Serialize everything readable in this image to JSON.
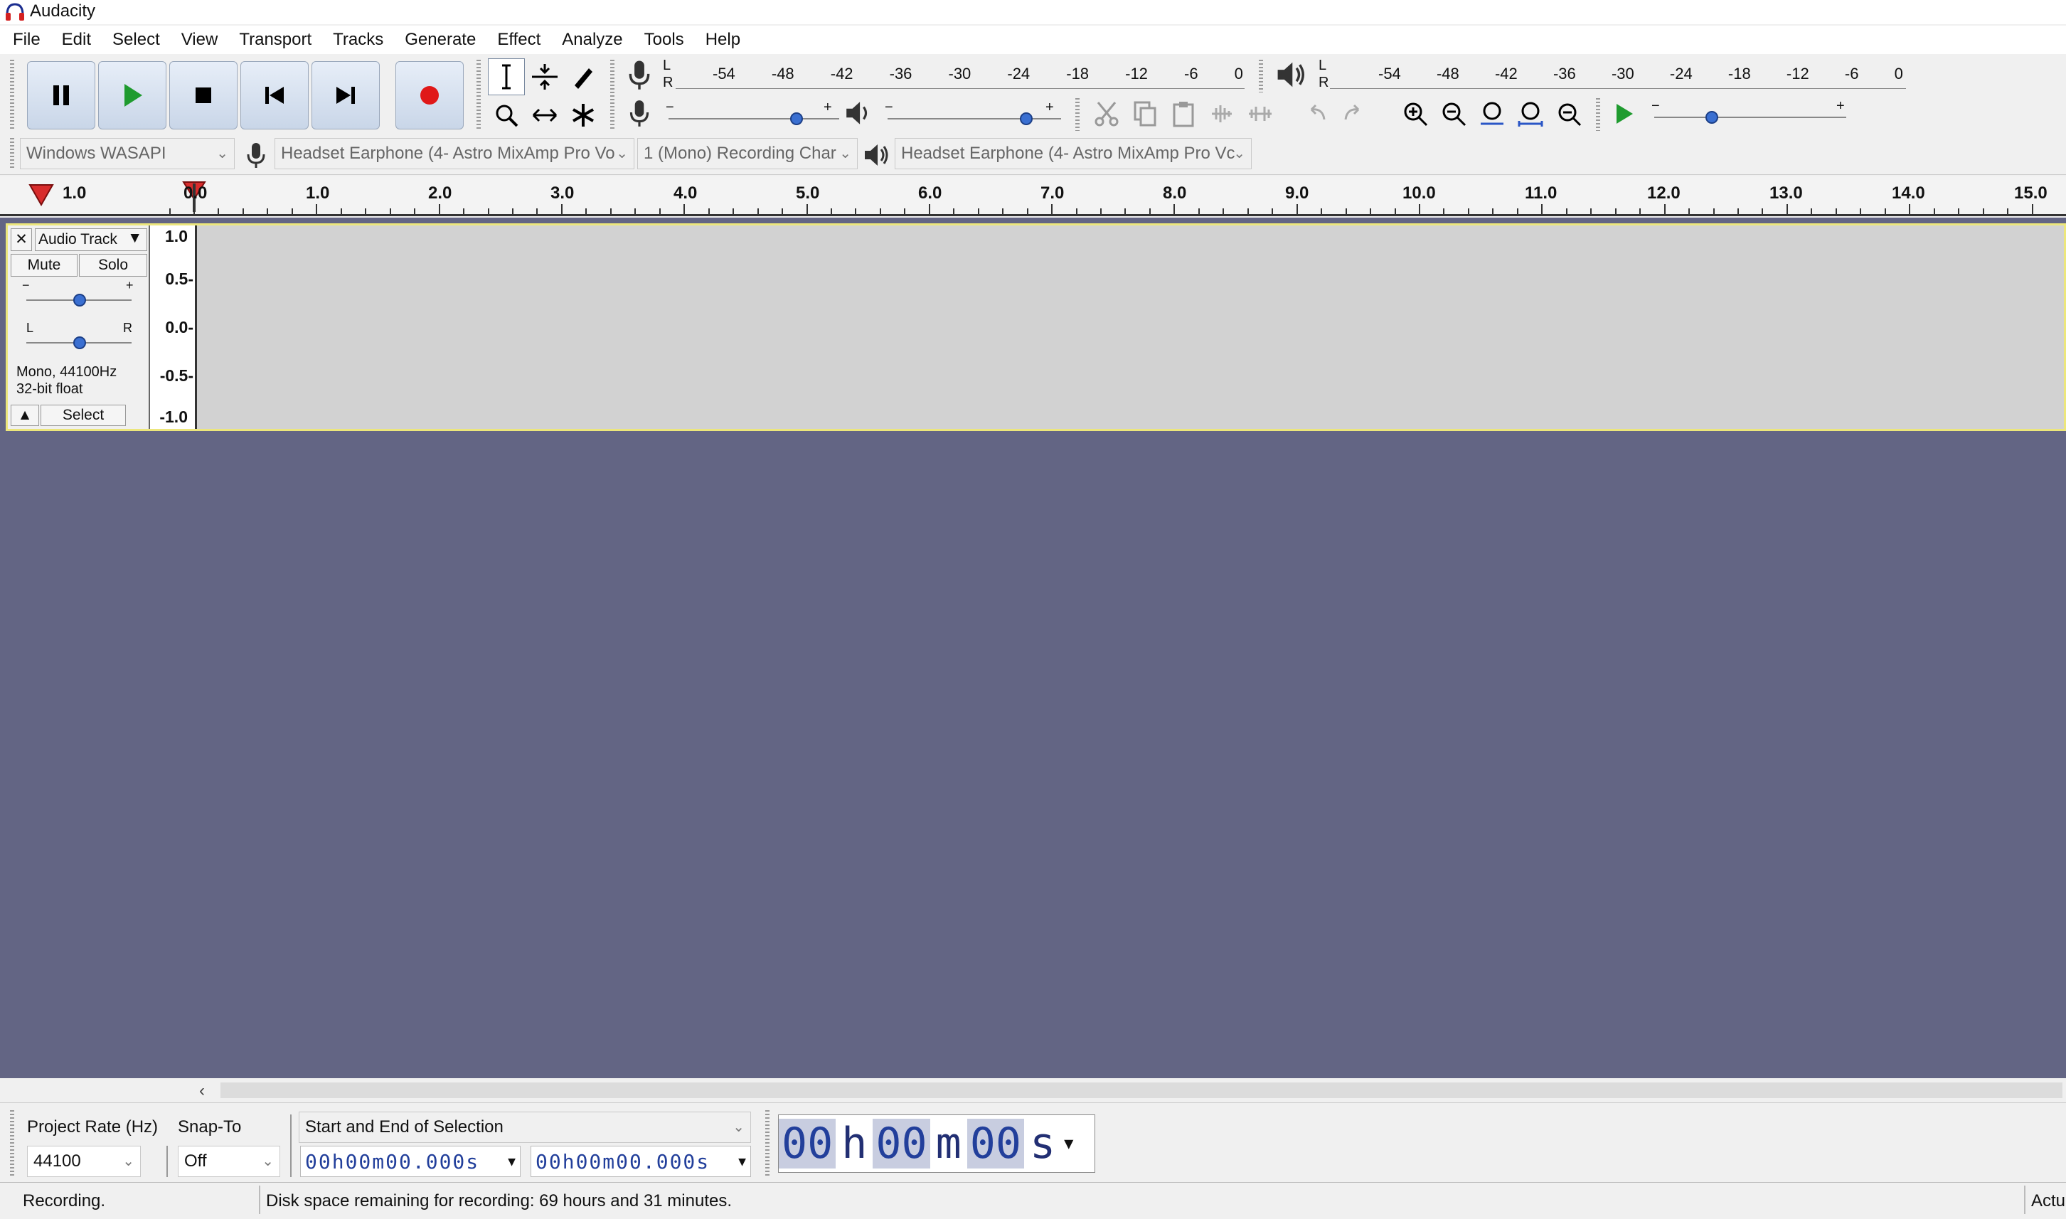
{
  "window": {
    "title": "Audacity"
  },
  "menu": [
    "File",
    "Edit",
    "Select",
    "View",
    "Transport",
    "Tracks",
    "Generate",
    "Effect",
    "Analyze",
    "Tools",
    "Help"
  ],
  "meters": {
    "record_scale": [
      "-54",
      "-48",
      "-42",
      "-36",
      "-30",
      "-24",
      "-18",
      "-12",
      "-6",
      "0"
    ],
    "play_scale": [
      "-54",
      "-48",
      "-42",
      "-36",
      "-30",
      "-24",
      "-18",
      "-12",
      "-6",
      "0"
    ],
    "lr": [
      "L",
      "R"
    ],
    "record_volume": 0.75,
    "playback_volume": 0.8,
    "play_at_speed": 0.3
  },
  "device": {
    "host": "Windows WASAPI",
    "recording_device": "Headset Earphone (4- Astro MixAmp Pro Vo",
    "channels": "1 (Mono) Recording Char",
    "playback_device": "Headset Earphone (4- Astro MixAmp Pro Vc"
  },
  "ruler": {
    "labels": [
      "1.0",
      "0.0",
      "1.0",
      "2.0",
      "3.0",
      "4.0",
      "5.0",
      "6.0",
      "7.0",
      "8.0",
      "9.0",
      "10.0",
      "11.0",
      "12.0",
      "13.0",
      "14.0",
      "15.0"
    ]
  },
  "track": {
    "name": "Audio Track",
    "close": "✕",
    "mute": "Mute",
    "solo": "Solo",
    "gain_minus": "−",
    "gain_plus": "+",
    "pan_left": "L",
    "pan_right": "R",
    "format_line1": "Mono, 44100Hz",
    "format_line2": "32-bit float",
    "select": "Select",
    "vscale": [
      "1.0",
      "0.5-",
      "0.0-",
      "-0.5-",
      "-1.0"
    ]
  },
  "selection": {
    "project_rate_label": "Project Rate (Hz)",
    "project_rate": "44100",
    "snap_to_label": "Snap-To",
    "snap_to": "Off",
    "mode": "Start and End of Selection",
    "start_time": "00h00m00.000s",
    "end_time": "00h00m00.000s",
    "big_time": [
      "00",
      "h",
      "00",
      "m",
      "00",
      "s"
    ]
  },
  "status": {
    "left": "Recording.",
    "disk": "Disk space remaining for recording: 69 hours and 31 minutes.",
    "right": "Actu"
  }
}
